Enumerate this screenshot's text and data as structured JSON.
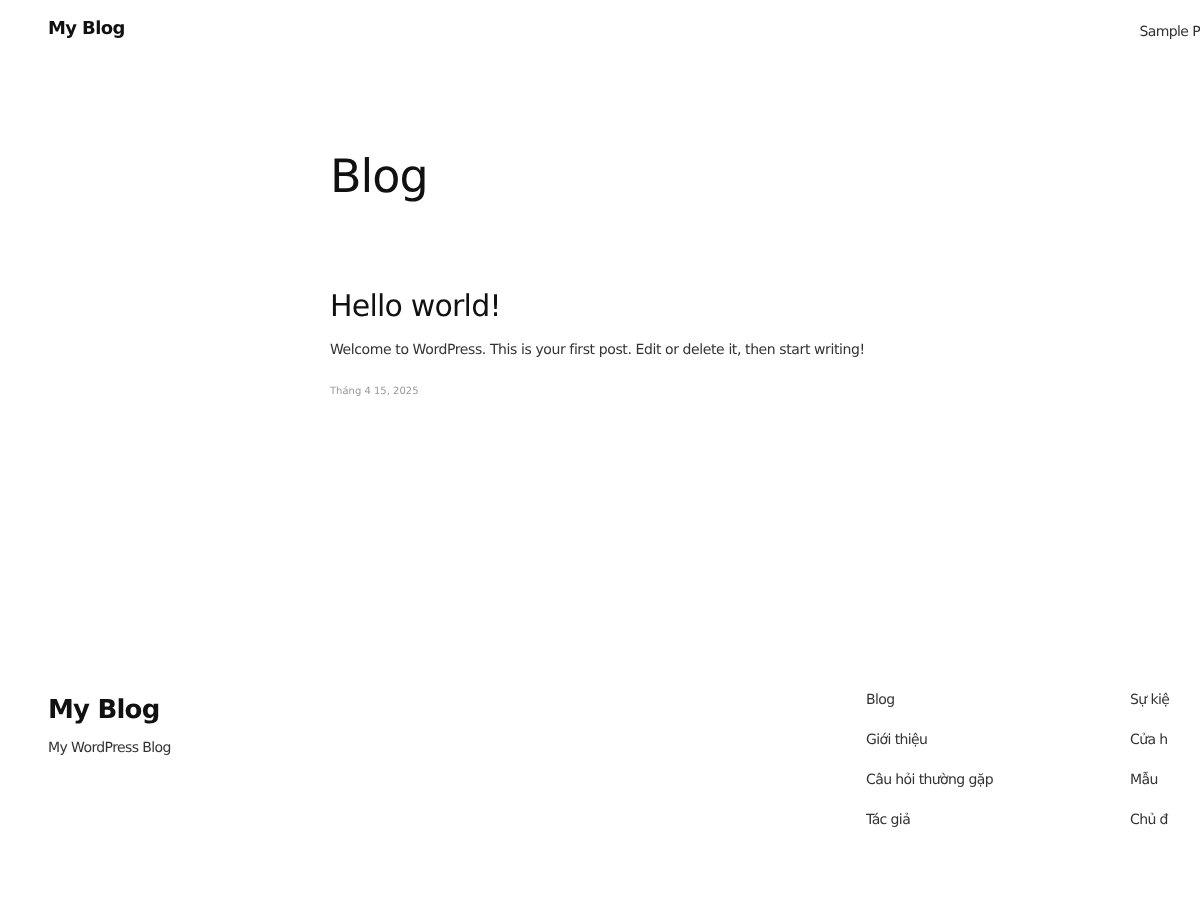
{
  "header": {
    "site_title": "My Blog",
    "nav": [
      "Sample P"
    ]
  },
  "page_title": "Blog",
  "posts": [
    {
      "title": "Hello world!",
      "excerpt": "Welcome to WordPress. This is your first post. Edit or delete it, then start writing!",
      "date": "Tháng 4 15, 2025"
    }
  ],
  "footer": {
    "site_title": "My Blog",
    "tagline": "My WordPress Blog",
    "columns": [
      [
        "Blog",
        "Giới thiệu",
        "Câu hỏi thường gặp",
        "Tác giả"
      ],
      [
        "Sự kiệ",
        "Cửa h",
        "Mẫu",
        "Chủ đ"
      ]
    ]
  }
}
